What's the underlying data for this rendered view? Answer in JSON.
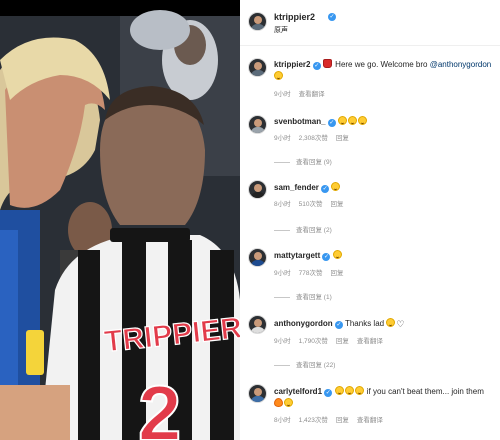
{
  "post": {
    "author": "ktrippier2",
    "subtitle": "原声",
    "shirt_name": "TRIPPIER",
    "shirt_number": "2"
  },
  "comments": [
    {
      "user": "ktrippier2",
      "text_before": " Here we go. Welcome bro ",
      "mention": "@anthonygordon",
      "time": "9小时",
      "translate": "查看翻译"
    },
    {
      "user": "svenbotman_",
      "time": "9小时",
      "likes": "2,308次赞",
      "reply": "回复",
      "view_replies": "查看回复 (9)"
    },
    {
      "user": "sam_fender",
      "time": "8小时",
      "likes": "510次赞",
      "reply": "回复",
      "view_replies": "查看回复 (2)"
    },
    {
      "user": "mattytargett",
      "time": "9小时",
      "likes": "778次赞",
      "reply": "回复",
      "view_replies": "查看回复 (1)"
    },
    {
      "user": "anthonygordon",
      "text": "Thanks lad ",
      "time": "9小时",
      "likes": "1,790次赞",
      "reply": "回复",
      "translate": "查看翻译",
      "view_replies": "查看回复 (22)"
    },
    {
      "user": "carlytelford1",
      "text": " if you can't beat them... join them ",
      "time": "8小时",
      "likes": "1,423次赞",
      "reply": "回复",
      "translate": "查看翻译"
    }
  ],
  "colors": {
    "verified": "#3897f0",
    "mention": "#00376b",
    "meta": "#8e8e8e"
  }
}
